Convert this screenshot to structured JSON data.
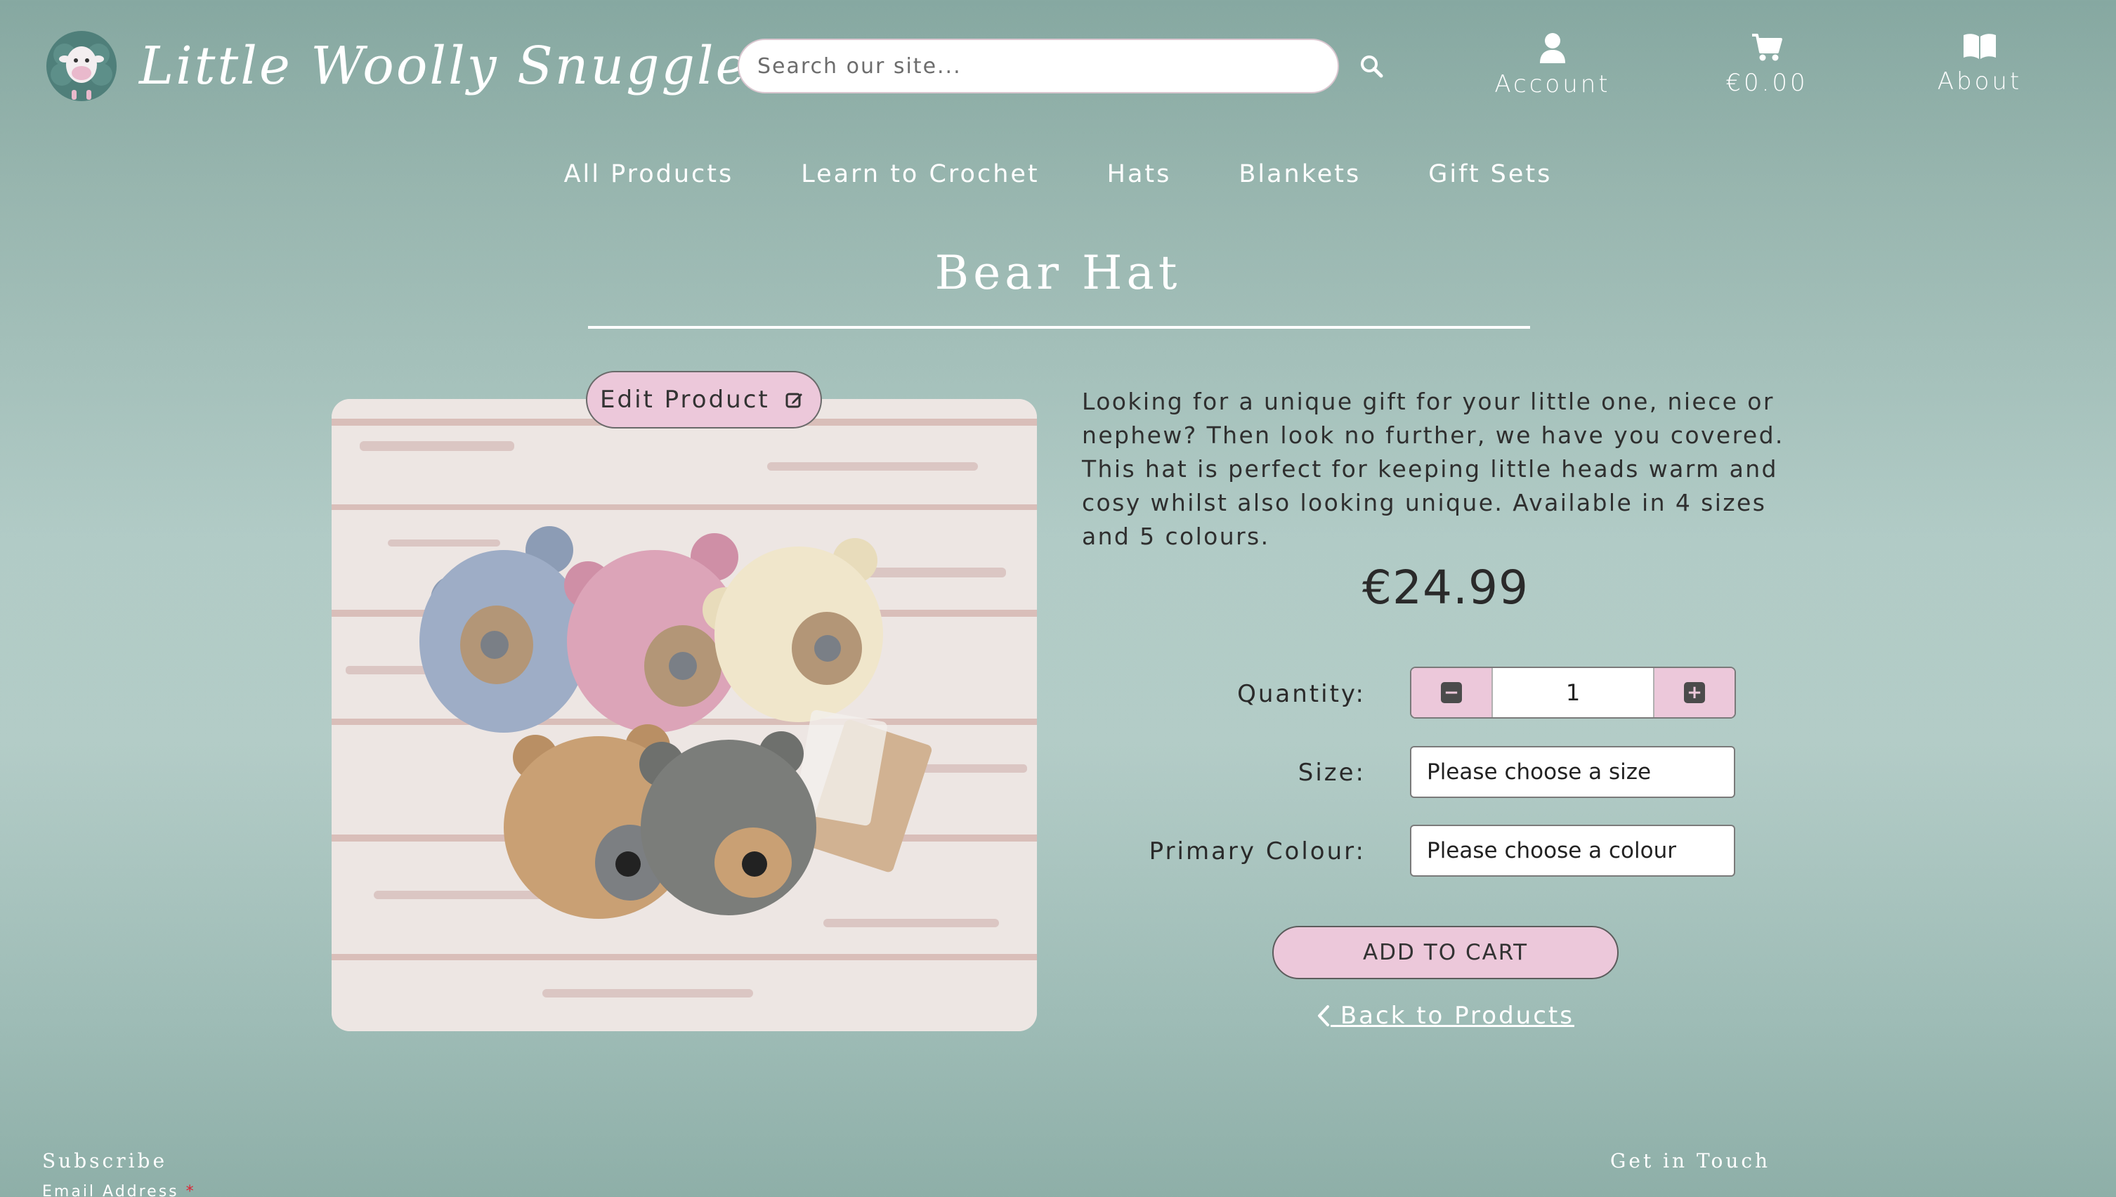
{
  "brand": {
    "name": "Little Woolly Snuggles"
  },
  "search": {
    "placeholder": "Search our site..."
  },
  "header_links": {
    "account": "Account",
    "cart_total": "€0.00",
    "about": "About"
  },
  "nav": {
    "items": [
      "All Products",
      "Learn to Crochet",
      "Hats",
      "Blankets",
      "Gift Sets"
    ]
  },
  "product": {
    "title": "Bear Hat",
    "edit_label": "Edit Product",
    "description": "Looking for a unique gift for your little one, niece or nephew? Then look no further, we have you covered. This hat is perfect for keeping little heads warm and cosy whilst also looking unique. Available in 4 sizes and 5 colours.",
    "price": "€24.99",
    "quantity_label": "Quantity:",
    "quantity_value": "1",
    "size_label": "Size:",
    "size_value": "Please choose a size",
    "colour_label": "Primary Colour:",
    "colour_value": "Please choose a colour",
    "add_to_cart": "ADD TO CART",
    "back_link": " Back to Products"
  },
  "footer": {
    "subscribe": "Subscribe",
    "email_label": "Email Address",
    "get_in_touch": "Get in Touch"
  },
  "colors": {
    "accent_pink": "#ecc8da",
    "background_teal": "#b1cbc6",
    "text_white": "#ffffff"
  },
  "icons": {
    "search": "search-icon",
    "account": "user-icon",
    "cart": "cart-icon",
    "about": "book-icon",
    "edit": "edit-icon",
    "back": "chevron-left-icon"
  }
}
